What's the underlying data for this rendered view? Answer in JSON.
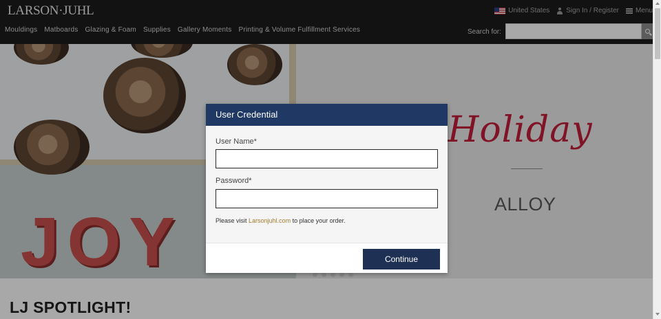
{
  "header": {
    "logo": "LARSON·JUHL",
    "country": "United States",
    "sign_in": "Sign In / Register",
    "menu": "Menu"
  },
  "nav": {
    "items": [
      {
        "label": "Mouldings"
      },
      {
        "label": "Matboards"
      },
      {
        "label": "Glazing & Foam"
      },
      {
        "label": "Supplies"
      },
      {
        "label": "Gallery Moments"
      },
      {
        "label": "Printing & Volume Fulfillment Services"
      }
    ]
  },
  "search": {
    "label": "Search for:",
    "value": ""
  },
  "hero": {
    "joy_letters": [
      "J",
      "O",
      "Y"
    ],
    "title": "Holiday",
    "subtitle": "ALLOY"
  },
  "spotlight": {
    "title": "LJ SPOTLIGHT!"
  },
  "modal": {
    "title": "User Credential",
    "username_label": "User Name*",
    "username_value": "",
    "password_label": "Password*",
    "password_value": "",
    "note_prefix": "Please visit ",
    "note_link": "Larsonjuhl.com",
    "note_suffix": " to place your order.",
    "continue_label": "Continue"
  },
  "colors": {
    "topbar": "#1c1c1c",
    "modal_header": "#1f3864",
    "button": "#1f3055",
    "hero_title": "#c21f3a",
    "link": "#a07c2a"
  }
}
